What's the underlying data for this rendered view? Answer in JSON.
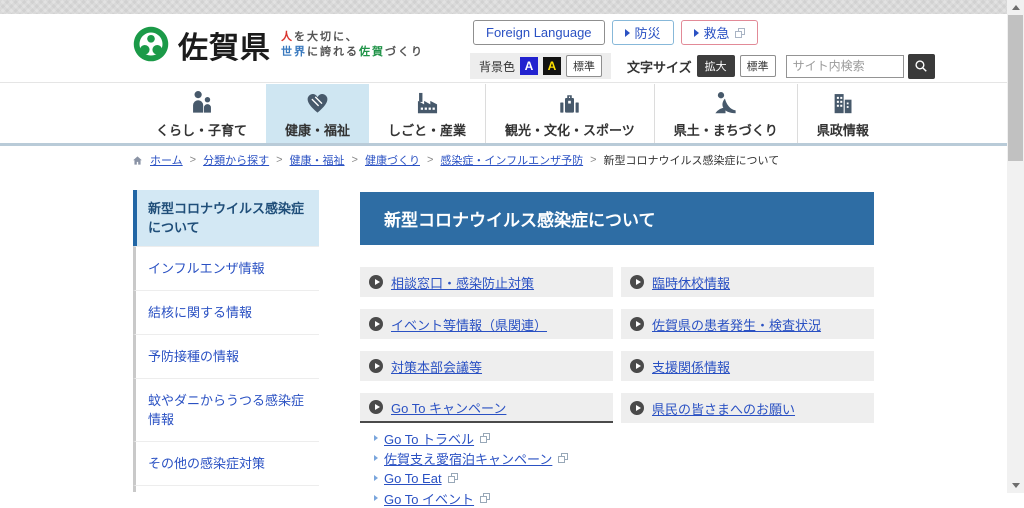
{
  "colors": {
    "banner_blue": "#2e6da4",
    "link_blue": "#2a51c3",
    "nav_highlight": "#cfe6f2",
    "sidebar_active_bg": "#d3e8f4",
    "sidebar_active_border": "#2166a5",
    "logo_green": "#1b9a48",
    "tagline_red": "#d9342e",
    "tagline_blue": "#3a7abf",
    "box_gray": "#eeeeee",
    "dark_button": "#3d3d3d"
  },
  "header": {
    "logo_text": "佐賀県",
    "tagline": {
      "accent1": "人",
      "rest1": "を大切に、",
      "accent2": "世界",
      "mid": "に誇れる",
      "accent3": "佐賀",
      "rest2": "づくり"
    },
    "buttons": {
      "foreign_language": "Foreign Language",
      "disaster": "防災",
      "emergency": "救急"
    },
    "controls": {
      "bg_label": "背景色",
      "bg_blue": "A",
      "bg_black": "A",
      "bg_default": "標準",
      "size_label": "文字サイズ",
      "size_large": "拡大",
      "size_default": "標準",
      "search_placeholder": "サイト内検索"
    }
  },
  "nav": {
    "items": [
      {
        "label": "くらし・子育て"
      },
      {
        "label": "健康・福祉"
      },
      {
        "label": "しごと・産業"
      },
      {
        "label": "観光・文化・スポーツ"
      },
      {
        "label": "県土・まちづくり"
      },
      {
        "label": "県政情報"
      }
    ]
  },
  "breadcrumb": {
    "home": "ホーム",
    "links": [
      "分類から探す",
      "健康・福祉",
      "健康づくり",
      "感染症・インフルエンザ予防"
    ],
    "current": "新型コロナウイルス感染症について"
  },
  "sidebar": {
    "items": [
      {
        "label": "新型コロナウイルス感染症について"
      },
      {
        "label": "インフルエンザ情報"
      },
      {
        "label": "結核に関する情報"
      },
      {
        "label": "予防接種の情報"
      },
      {
        "label": "蚊やダニからうつる感染症情報"
      },
      {
        "label": "その他の感染症対策"
      }
    ]
  },
  "main": {
    "title": "新型コロナウイルス感染症について",
    "boxes": [
      "相談窓口・感染防止対策",
      "臨時休校情報",
      "イベント等情報（県関連）",
      "佐賀県の患者発生・検査状況",
      "対策本部会議等",
      "支援関係情報",
      "Go To キャンペーン",
      "県民の皆さまへのお願い"
    ],
    "sub_links": [
      "Go To トラベル",
      "佐賀支え愛宿泊キャンペーン",
      "Go To Eat",
      "Go To イベント"
    ]
  }
}
